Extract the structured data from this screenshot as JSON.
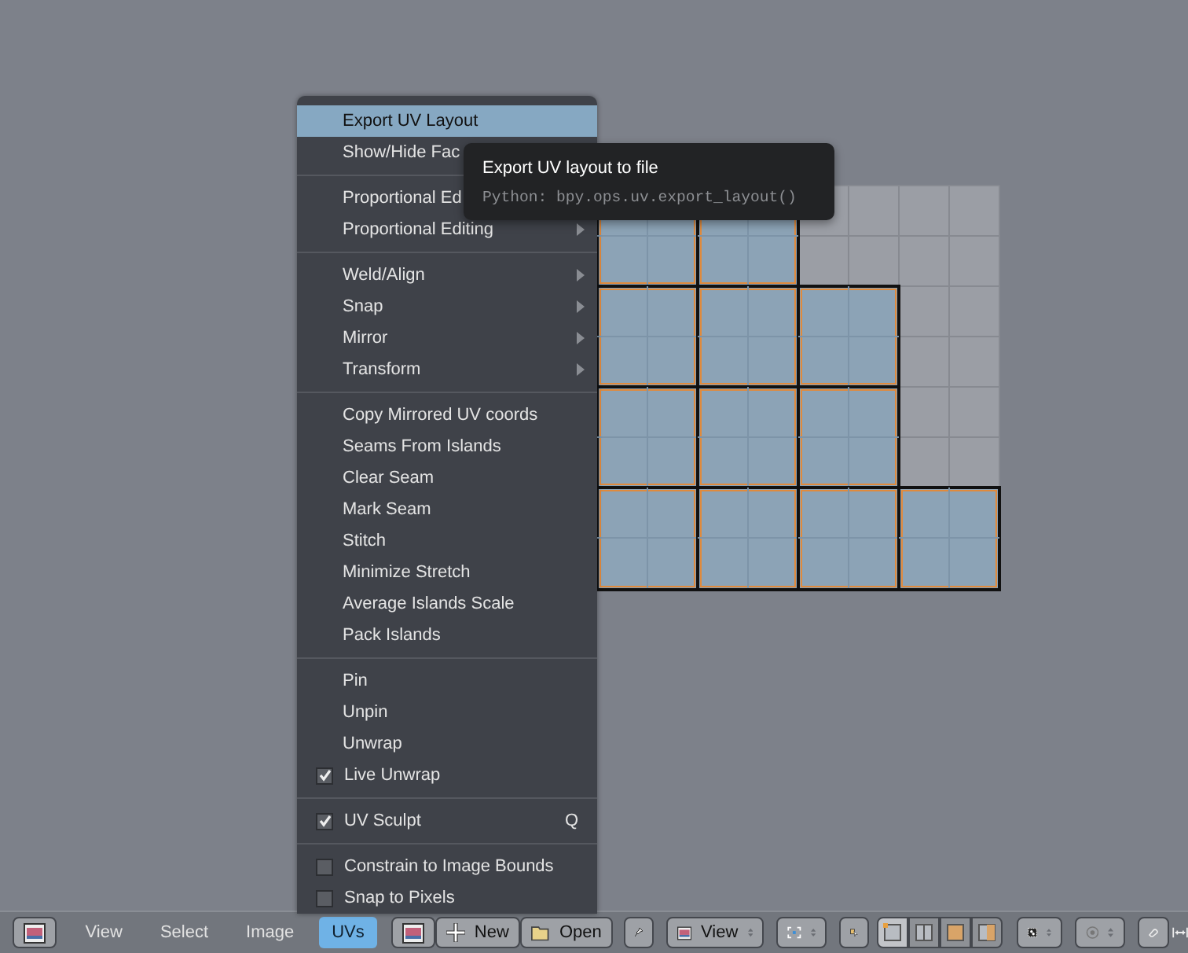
{
  "uv_menu": {
    "items": [
      {
        "kind": "item",
        "label": "Export UV Layout",
        "selected": true
      },
      {
        "kind": "item",
        "label": "Show/Hide Fac",
        "selected": false
      },
      {
        "kind": "separator"
      },
      {
        "kind": "item",
        "label": "Proportional Ed",
        "selected": false
      },
      {
        "kind": "submenu",
        "label": "Proportional Editing",
        "selected": false
      },
      {
        "kind": "separator"
      },
      {
        "kind": "submenu",
        "label": "Weld/Align",
        "selected": false
      },
      {
        "kind": "submenu",
        "label": "Snap",
        "selected": false
      },
      {
        "kind": "submenu",
        "label": "Mirror",
        "selected": false
      },
      {
        "kind": "submenu",
        "label": "Transform",
        "selected": false
      },
      {
        "kind": "separator"
      },
      {
        "kind": "item",
        "label": "Copy Mirrored UV coords",
        "selected": false
      },
      {
        "kind": "item",
        "label": "Seams From Islands",
        "selected": false
      },
      {
        "kind": "item",
        "label": "Clear Seam",
        "selected": false
      },
      {
        "kind": "item",
        "label": "Mark Seam",
        "selected": false
      },
      {
        "kind": "item",
        "label": "Stitch",
        "selected": false
      },
      {
        "kind": "item",
        "label": "Minimize Stretch",
        "selected": false
      },
      {
        "kind": "item",
        "label": "Average Islands Scale",
        "selected": false
      },
      {
        "kind": "item",
        "label": "Pack Islands",
        "selected": false
      },
      {
        "kind": "separator"
      },
      {
        "kind": "item",
        "label": "Pin",
        "selected": false
      },
      {
        "kind": "item",
        "label": "Unpin",
        "selected": false
      },
      {
        "kind": "item",
        "label": "Unwrap",
        "selected": false
      },
      {
        "kind": "check",
        "label": "Live Unwrap",
        "checked": true,
        "selected": false
      },
      {
        "kind": "separator"
      },
      {
        "kind": "check",
        "label": "UV Sculpt",
        "checked": true,
        "shortcut": "Q",
        "selected": false
      },
      {
        "kind": "separator"
      },
      {
        "kind": "check",
        "label": "Constrain to Image Bounds",
        "checked": false,
        "selected": false
      },
      {
        "kind": "check",
        "label": "Snap to Pixels",
        "checked": false,
        "selected": false
      }
    ]
  },
  "tooltip": {
    "title": "Export UV layout to file",
    "python": "Python: bpy.ops.uv.export_layout()"
  },
  "header": {
    "menus": [
      {
        "label": "View",
        "selected": false
      },
      {
        "label": "Select",
        "selected": false
      },
      {
        "label": "Image",
        "selected": false
      },
      {
        "label": "UVs",
        "selected": true
      }
    ],
    "new_button": "New",
    "open_button": "Open",
    "view_dropdown": "View",
    "selection_modes": [
      {
        "selected": true
      },
      {
        "selected": false
      },
      {
        "selected": false
      },
      {
        "selected": false
      }
    ]
  }
}
